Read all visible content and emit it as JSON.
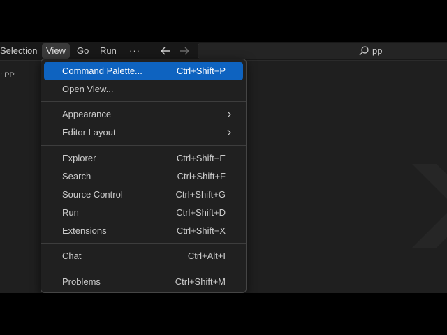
{
  "menubar": {
    "items": [
      {
        "label": "Selection"
      },
      {
        "label": "View"
      },
      {
        "label": "Go"
      },
      {
        "label": "Run"
      },
      {
        "label": "···"
      }
    ],
    "search_text": "pp"
  },
  "sidebar": {
    "label": ": PP"
  },
  "view_menu": {
    "groups": [
      [
        {
          "label": "Command Palette...",
          "shortcut": "Ctrl+Shift+P",
          "highlighted": true
        },
        {
          "label": "Open View...",
          "shortcut": ""
        }
      ],
      [
        {
          "label": "Appearance",
          "submenu": true
        },
        {
          "label": "Editor Layout",
          "submenu": true
        }
      ],
      [
        {
          "label": "Explorer",
          "shortcut": "Ctrl+Shift+E"
        },
        {
          "label": "Search",
          "shortcut": "Ctrl+Shift+F"
        },
        {
          "label": "Source Control",
          "shortcut": "Ctrl+Shift+G"
        },
        {
          "label": "Run",
          "shortcut": "Ctrl+Shift+D"
        },
        {
          "label": "Extensions",
          "shortcut": "Ctrl+Shift+X"
        }
      ],
      [
        {
          "label": "Chat",
          "shortcut": "Ctrl+Alt+I"
        }
      ],
      [
        {
          "label": "Problems",
          "shortcut": "Ctrl+Shift+M"
        }
      ]
    ]
  },
  "colors": {
    "highlight": "#0e63c0",
    "menu_bg": "#202020",
    "editor_bg": "#1f1f1f"
  },
  "icons": {
    "back": "arrow-left-icon",
    "forward": "arrow-right-icon",
    "search": "search-icon",
    "submenu": "chevron-right-icon"
  }
}
